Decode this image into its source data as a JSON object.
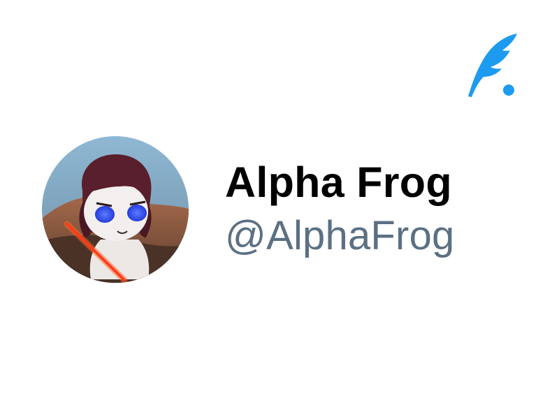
{
  "profile": {
    "display_name": "Alpha Frog",
    "handle": "@AlphaFrog"
  },
  "icons": {
    "brand_logo": "feather-quill-icon",
    "avatar": "avatar-illustration"
  },
  "colors": {
    "background": "#ffffff",
    "name_text": "#000000",
    "handle_text": "#5b7083",
    "brand_accent": "#1d9bf0"
  }
}
